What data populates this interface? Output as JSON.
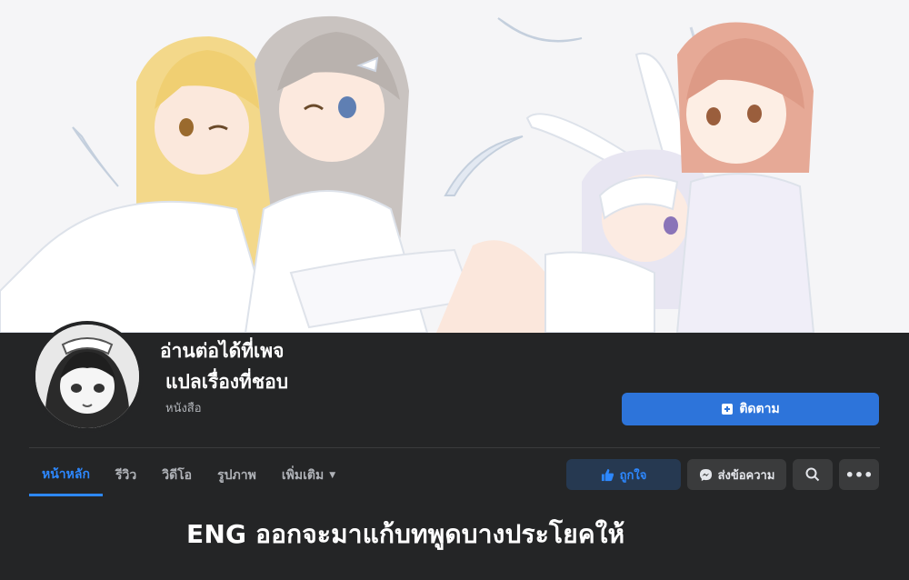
{
  "page": {
    "name_line1": "อ่านต่อได้ที่เพจ",
    "name_line2": "แปลเรื่องที่ชอบ",
    "category": "หนังสือ"
  },
  "buttons": {
    "follow_label": "ติดตาม",
    "like_label": "ถูกใจ",
    "message_label": "ส่งข้อความ"
  },
  "tabs": [
    {
      "label": "หน้าหลัก",
      "active": true
    },
    {
      "label": "รีวิว",
      "active": false
    },
    {
      "label": "วิดีโอ",
      "active": false
    },
    {
      "label": "รูปภาพ",
      "active": false
    },
    {
      "label": "เพิ่มเติม",
      "active": false
    }
  ],
  "caption": "ENG ออกจะมาแก้บทพูดบางประโยคให้",
  "icons": {
    "follow": "bookmark-plus-icon",
    "like": "thumbs-up-icon",
    "message": "messenger-icon",
    "search": "search-icon",
    "more": "more-dots-icon",
    "dropdown": "caret-down-icon"
  },
  "colors": {
    "background": "#242526",
    "accent": "#2d74da",
    "accent_text": "#2d88ff",
    "secondary_button": "#3a3b3c"
  }
}
